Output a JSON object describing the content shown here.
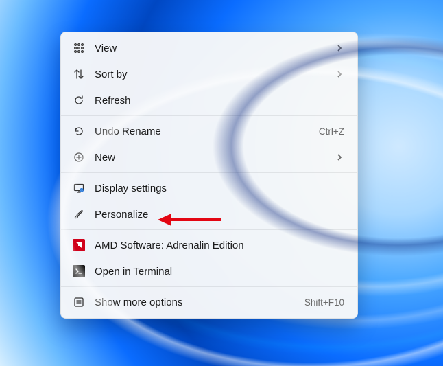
{
  "menu": {
    "groups": [
      [
        {
          "id": "view",
          "icon": "grid",
          "label": "View",
          "submenu": true
        },
        {
          "id": "sort",
          "icon": "sort",
          "label": "Sort by",
          "submenu": true
        },
        {
          "id": "refresh",
          "icon": "refresh",
          "label": "Refresh"
        }
      ],
      [
        {
          "id": "undo",
          "icon": "undo",
          "label": "Undo Rename",
          "shortcut": "Ctrl+Z"
        },
        {
          "id": "new",
          "icon": "plus",
          "label": "New",
          "submenu": true
        }
      ],
      [
        {
          "id": "display",
          "icon": "display",
          "label": "Display settings"
        },
        {
          "id": "personalize",
          "icon": "brush",
          "label": "Personalize"
        }
      ],
      [
        {
          "id": "amd",
          "icon": "amd",
          "label": "AMD Software: Adrenalin Edition"
        },
        {
          "id": "terminal",
          "icon": "terminal",
          "label": "Open in Terminal"
        }
      ],
      [
        {
          "id": "more",
          "icon": "more",
          "label": "Show more options",
          "shortcut": "Shift+F10"
        }
      ]
    ]
  },
  "annotation": {
    "target": "personalize",
    "color": "#e30613"
  }
}
